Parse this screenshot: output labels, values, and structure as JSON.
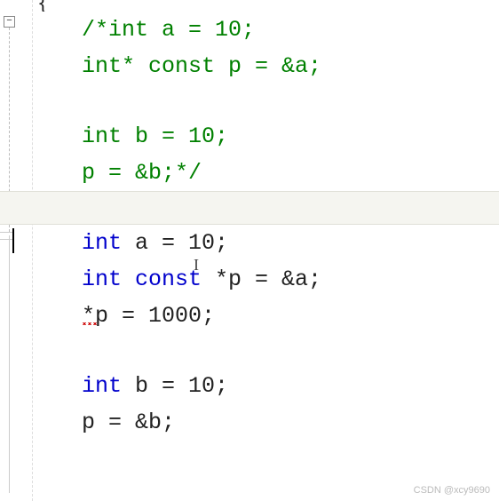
{
  "editor": {
    "fold_symbol": "−",
    "brace": "{",
    "caret_visible": true
  },
  "code": {
    "line1": "/*int a = 10;",
    "line2": "int* const p = &a;",
    "line3": "",
    "line4": "int b = 10;",
    "line5": "p = &b;*/",
    "line6": "",
    "line7_kw": "int",
    "line7_rest": " a = 10;",
    "line8_kw1": "int",
    "line8_kw2": " const",
    "line8_rest": " *p = &a;",
    "line9_pre": "*",
    "line9_var": "p",
    "line9_rest": " = 1000;",
    "line10": "",
    "line11_kw": "int",
    "line11_rest": " b = 10;",
    "line12": "p = &b;"
  },
  "watermark": "CSDN @xcy9690"
}
